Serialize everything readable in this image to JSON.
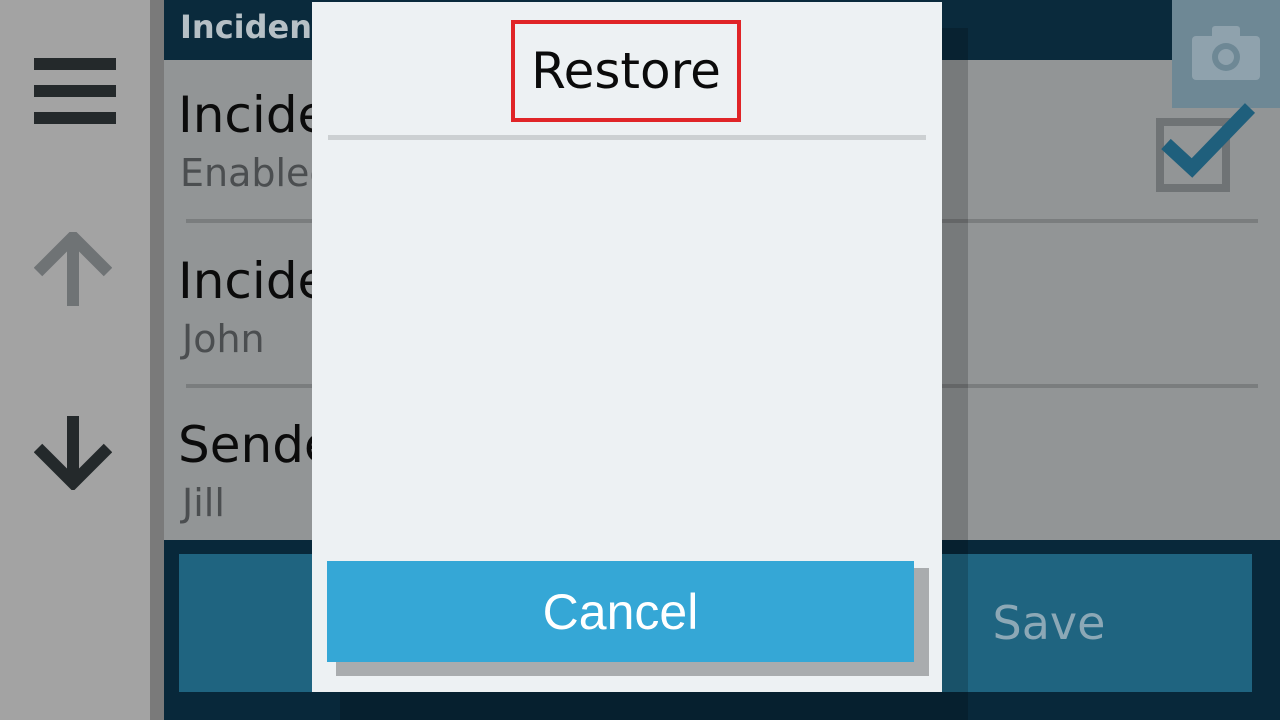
{
  "app": {
    "header_title": "Incident",
    "fields": [
      {
        "label": "Incide",
        "value": "Enabled"
      },
      {
        "label": "Incide",
        "value": "John"
      },
      {
        "label": "Sende",
        "value": "Jill"
      }
    ],
    "save_label": "Save",
    "colors": {
      "accent": "#35a7d6",
      "header": "#0a2a3c",
      "highlight": "#e02427"
    }
  },
  "sidebar": {
    "icons": [
      "menu-icon",
      "arrow-up-icon",
      "arrow-down-icon"
    ]
  },
  "dialog": {
    "title": "Restore",
    "cancel_label": "Cancel"
  }
}
